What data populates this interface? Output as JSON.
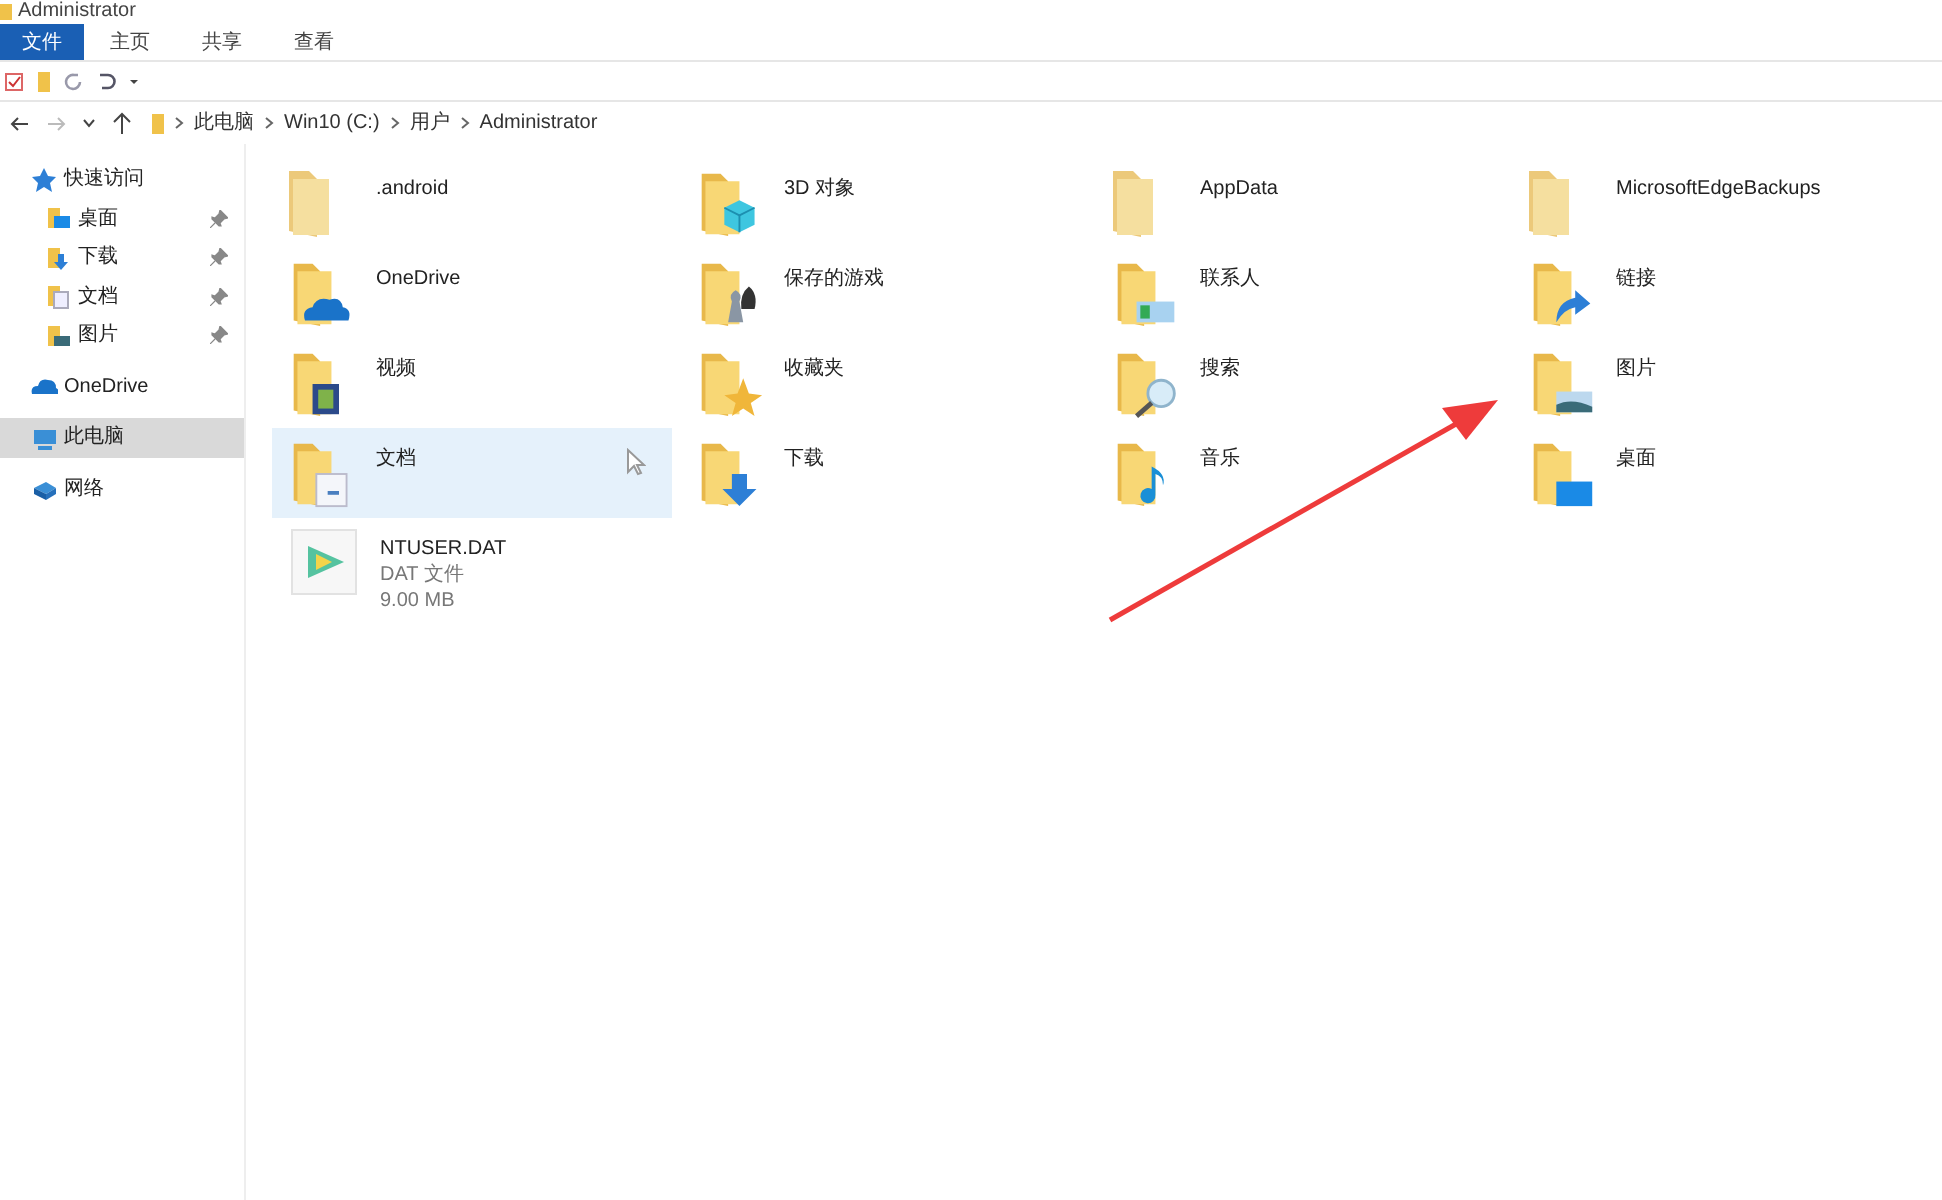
{
  "window": {
    "title": "Administrator"
  },
  "ribbon_tabs": [
    {
      "label": "文件",
      "selected": true
    },
    {
      "label": "主页",
      "selected": false
    },
    {
      "label": "共享",
      "selected": false
    },
    {
      "label": "查看",
      "selected": false
    }
  ],
  "address": {
    "crumbs": [
      "此电脑",
      "Win10 (C:)",
      "用户",
      "Administrator"
    ]
  },
  "sidebar": {
    "items": [
      {
        "label": "快速访问",
        "kind": "star",
        "selected": false,
        "children": [
          {
            "label": "桌面",
            "kind": "desktop",
            "pinned": true,
            "selected": false
          },
          {
            "label": "下载",
            "kind": "download",
            "pinned": true,
            "selected": false
          },
          {
            "label": "文档",
            "kind": "doc",
            "pinned": true,
            "selected": false
          },
          {
            "label": "图片",
            "kind": "picture",
            "pinned": true,
            "selected": false
          }
        ]
      },
      {
        "label": "OneDrive",
        "kind": "cloud",
        "selected": false
      },
      {
        "label": "此电脑",
        "kind": "pc",
        "selected": true
      },
      {
        "label": "网络",
        "kind": "network",
        "selected": false
      }
    ]
  },
  "items": [
    {
      "name": ".android",
      "kind": "hidden",
      "selected": false
    },
    {
      "name": "3D 对象",
      "kind": "cube",
      "selected": false
    },
    {
      "name": "AppData",
      "kind": "hidden",
      "selected": false
    },
    {
      "name": "MicrosoftEdgeBackups",
      "kind": "hidden",
      "selected": false
    },
    {
      "name": "OneDrive",
      "kind": "cloud",
      "selected": false
    },
    {
      "name": "保存的游戏",
      "kind": "chess",
      "selected": false
    },
    {
      "name": "联系人",
      "kind": "contact",
      "selected": false
    },
    {
      "name": "链接",
      "kind": "link",
      "selected": false
    },
    {
      "name": "视频",
      "kind": "video",
      "selected": false
    },
    {
      "name": "收藏夹",
      "kind": "star",
      "selected": false
    },
    {
      "name": "搜索",
      "kind": "search",
      "selected": false
    },
    {
      "name": "图片",
      "kind": "picture",
      "selected": false
    },
    {
      "name": "文档",
      "kind": "doc",
      "selected": true
    },
    {
      "name": "下载",
      "kind": "download",
      "selected": false
    },
    {
      "name": "音乐",
      "kind": "music",
      "selected": false
    },
    {
      "name": "桌面",
      "kind": "desktop",
      "selected": false
    },
    {
      "name": "NTUSER.DAT",
      "kind": "file",
      "selected": false,
      "details": [
        "DAT 文件",
        "9.00 MB"
      ]
    }
  ]
}
